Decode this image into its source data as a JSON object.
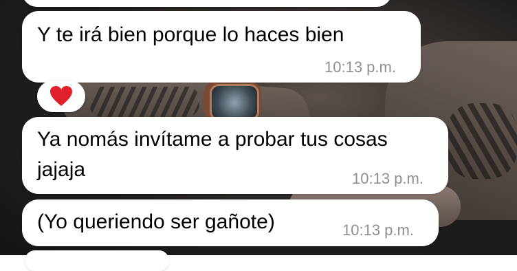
{
  "messages": [
    {
      "text": "Y te irá bien porque lo haces bien",
      "time": "10:13 p.m."
    },
    {
      "text_line1": "Ya nomás invítame a probar tus cosas",
      "text_line2": "jajaja",
      "time": "10:13 p.m."
    },
    {
      "text": "(Yo queriendo ser gañote)",
      "time": "10:13 p.m."
    }
  ],
  "reaction": {
    "icon": "red-heart-icon",
    "color": "#e0202a"
  },
  "colors": {
    "bubble": "#ffffff",
    "timestamp": "#8e8e93"
  }
}
